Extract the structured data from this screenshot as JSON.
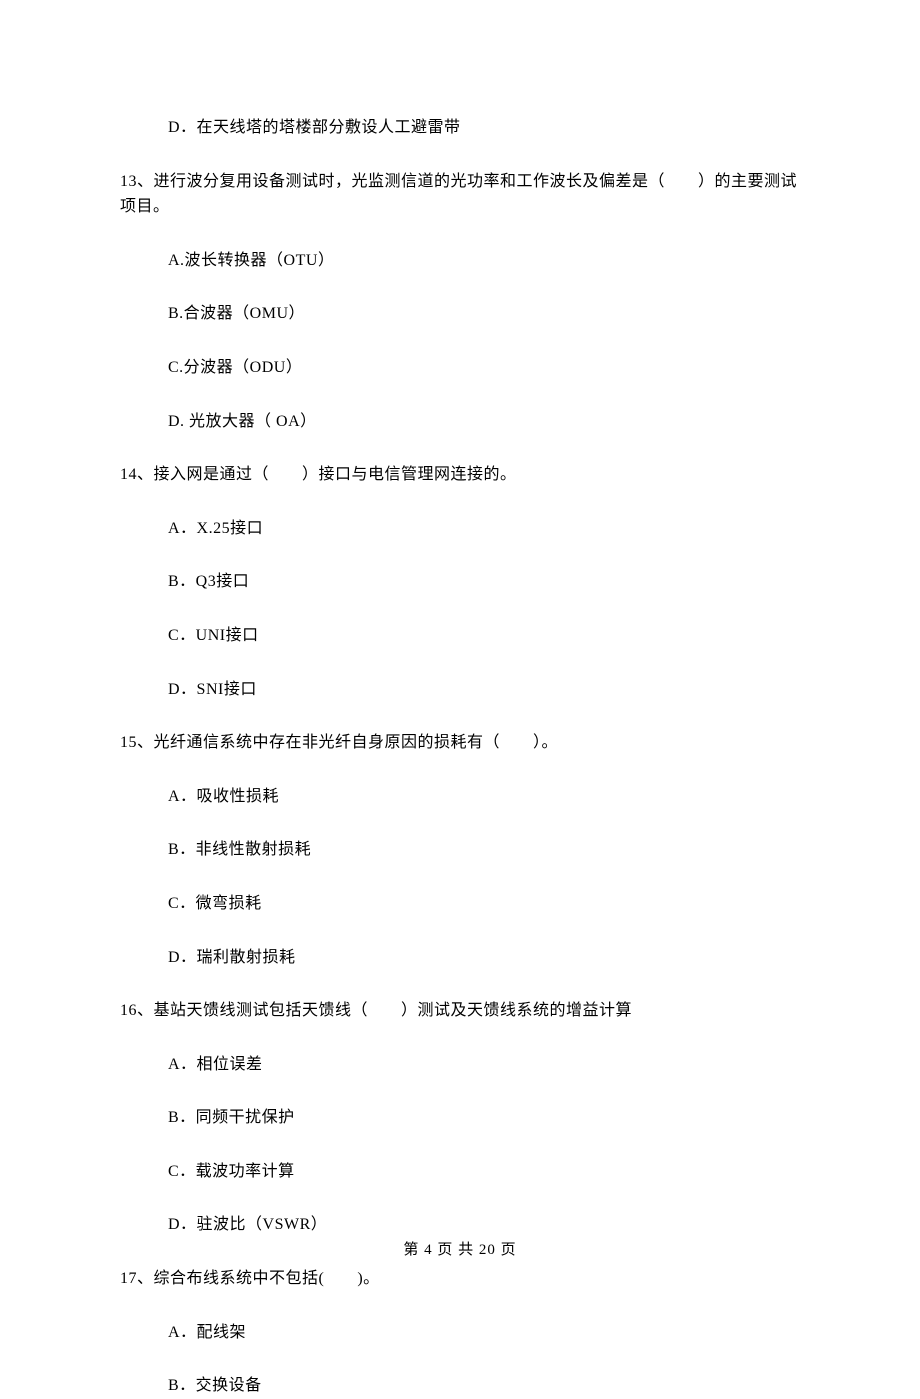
{
  "q12": {
    "optionD": "D．在天线塔的塔楼部分敷设人工避雷带"
  },
  "q13": {
    "stem": "13、进行波分复用设备测试时，光监测信道的光功率和工作波长及偏差是（　　）的主要测试项目。",
    "optionA": "A.波长转换器（OTU）",
    "optionB": "B.合波器（OMU）",
    "optionC": "C.分波器（ODU）",
    "optionD": "D. 光放大器（ OA）"
  },
  "q14": {
    "stem": "14、接入网是通过（　　）接口与电信管理网连接的。",
    "optionA": "A．X.25接口",
    "optionB": "B．Q3接口",
    "optionC": "C．UNI接口",
    "optionD": "D．SNI接口"
  },
  "q15": {
    "stem": "15、光纤通信系统中存在非光纤自身原因的损耗有（　　）。",
    "optionA": "A．吸收性损耗",
    "optionB": "B．非线性散射损耗",
    "optionC": "C．微弯损耗",
    "optionD": "D．瑞利散射损耗"
  },
  "q16": {
    "stem": "16、基站天馈线测试包括天馈线（　　）测试及天馈线系统的增益计算",
    "optionA": "A．相位误差",
    "optionB": "B．同频干扰保护",
    "optionC": "C．载波功率计算",
    "optionD": "D．驻波比（VSWR）"
  },
  "q17": {
    "stem": "17、综合布线系统中不包括(　　)。",
    "optionA": "A．配线架",
    "optionB": "B．交换设备"
  },
  "footer": "第 4 页 共 20 页"
}
